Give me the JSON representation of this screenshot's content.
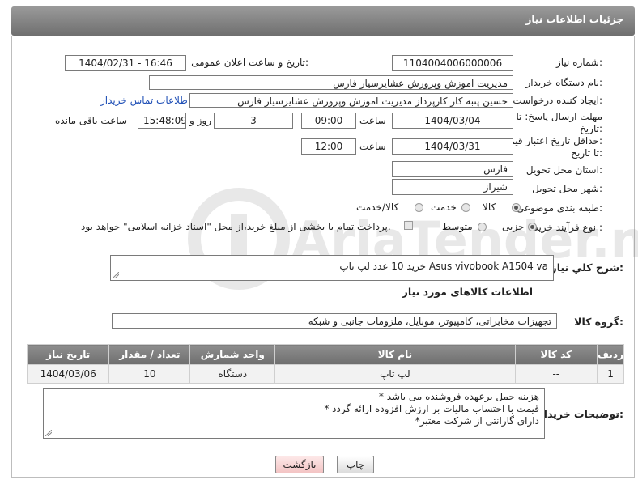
{
  "header": {
    "title": "جزئیات اطلاعات نیاز"
  },
  "fields": {
    "need_number_label": "شماره نیاز:",
    "need_number": "1104004006000006",
    "announce_label": "تاریخ و ساعت اعلان عمومی:",
    "announce_value": "1404/02/31 - 16:46",
    "buyer_org_label": "نام دستگاه خریدار:",
    "buyer_org": "مدیریت اموزش وپرورش عشایرسیار فارس",
    "creator_label": "ایجاد کننده درخواست:",
    "creator": "حسین پنبه کار کارپرداز مدیریت اموزش وپرورش عشایرسیار فارس",
    "contact_link": "اطلاعات تماس خریدار",
    "deadline_label_1": "مهلت ارسال پاسخ: تا",
    "deadline_label_2": "تاریخ:",
    "deadline_date": "1404/03/04",
    "time_word": "ساعت",
    "deadline_time": "09:00",
    "days_value": "3",
    "days_word": "روز و",
    "remaining_time": "15:48:09",
    "remaining_word": "ساعت باقی مانده",
    "validity_label_1": "حداقل تاریخ اعتبار قیمت:",
    "validity_label_2": "تا تاریخ:",
    "validity_date": "1404/03/31",
    "validity_time": "12:00",
    "province_label": "استان محل تحویل:",
    "province": "فارس",
    "city_label": "شهر محل تحویل:",
    "city": "شیراز",
    "category_label": "طبقه بندی موضوعی:",
    "category_options": [
      "کالا",
      "خدمت",
      "کالا/خدمت"
    ],
    "process_label": "نوع فرآیند خرید :",
    "process_options": [
      "جزیی",
      "متوسط"
    ],
    "payment_note": "پرداخت تمام یا بخشی از مبلغ خرید،از محل \"اسناد خزانه اسلامی\" خواهد بود."
  },
  "description": {
    "label": "شرح کلي نياز:",
    "text": "خرید  10 عدد لپ تاپ    Asus vivobook A1504 va"
  },
  "goods_info_title": "اطلاعات کالاهای مورد نیاز",
  "goods_group": {
    "label": "گروه کالا:",
    "value": "تجهیزات مخابراتی، کامپیوتر، موبایل، ملزومات جانبی و شبکه"
  },
  "table": {
    "headers": [
      "ردیف",
      "کد کالا",
      "نام کالا",
      "واحد شمارش",
      "تعداد / مقدار",
      "تاریخ نیاز"
    ],
    "rows": [
      [
        "1",
        "--",
        "لپ تاپ",
        "دستگاه",
        "10",
        "1404/03/06"
      ]
    ]
  },
  "buyer_notes": {
    "label": "توضیحات خریدار:",
    "lines": [
      "* هزینه حمل برعهده فروشنده می باشد",
      "* قیمت با احتساب مالیات بر ارزش افزوده ارائه گردد",
      "*دارای گارانتی از شرکت معتبر"
    ]
  },
  "buttons": {
    "print": "چاپ",
    "back": "بازگشت"
  },
  "watermark": {
    "text": "AriaTender.neT"
  },
  "colors": {
    "header": "#7a7a7a",
    "link": "#1f4fb6",
    "back_button": "#f7d0d0"
  }
}
